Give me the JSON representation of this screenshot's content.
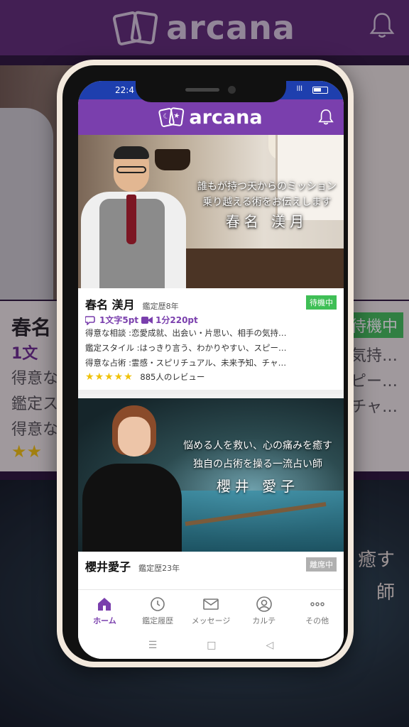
{
  "bg": {
    "brand": "arcana",
    "name": "春名",
    "price_fragment": "1文",
    "wait_badge": "待機中",
    "lines": [
      "得意な",
      "鑑定ス",
      "得意な"
    ],
    "right_lines": [
      "気持…",
      "スピー…",
      "チャ…"
    ],
    "stars": "★★",
    "photo2_caption": [
      "癒す",
      "師"
    ]
  },
  "status": {
    "time": "22:4",
    "signal": "lll"
  },
  "app": {
    "brand": "arcana",
    "accent": "#7a3fad",
    "statusbar_color": "#1e3fae"
  },
  "cards": [
    {
      "caption_l1": "誰もが持つ天からのミッション",
      "caption_l2": "乗り越える術をお伝えします",
      "caption_name": "春名 渼月",
      "name": "春名 渼月",
      "experience": "鑑定歴8年",
      "status": "待機中",
      "price_chat": "1文字5pt",
      "price_video": "1分220pt",
      "consult": "得意な相談 :恋愛成就、出会い・片思い、相手の気持…",
      "style": "鑑定スタイル :はっきり言う、わかりやすい、スピー…",
      "method": "得意な占術 :霊感・スピリチュアル、未来予知、チャ…",
      "stars": "★★★★★",
      "reviews": "885人のレビュー"
    },
    {
      "caption_l1": "悩める人を救い、心の痛みを癒す",
      "caption_l2": "独自の占術を操る一流占い師",
      "caption_name": "櫻井 愛子",
      "name": "櫻井愛子",
      "experience": "鑑定歴23年",
      "status": "離席中"
    }
  ],
  "tabs": [
    {
      "label": "ホーム",
      "icon": "home-icon"
    },
    {
      "label": "鑑定履歴",
      "icon": "history-icon"
    },
    {
      "label": "メッセージ",
      "icon": "mail-icon"
    },
    {
      "label": "カルテ",
      "icon": "user-icon"
    },
    {
      "label": "その他",
      "icon": "more-icon"
    }
  ],
  "nav": {
    "menu": "☰",
    "home": "□",
    "back": "◁"
  }
}
